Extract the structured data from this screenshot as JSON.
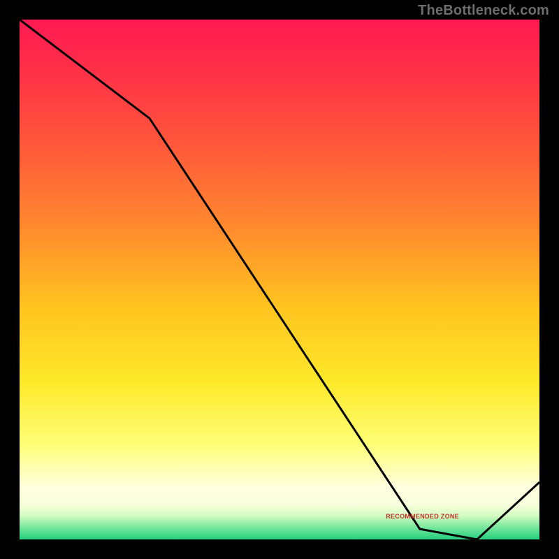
{
  "watermark": "TheBottleneck.com",
  "annotation_label": "RECOMMENDED ZONE",
  "annotation_pos": {
    "x_frac": 0.775,
    "y_frac": 0.955
  },
  "chart_data": {
    "type": "line",
    "title": "",
    "xlabel": "",
    "ylabel": "",
    "xlim": [
      0,
      1
    ],
    "ylim": [
      0,
      1
    ],
    "x": [
      0.0,
      0.25,
      0.77,
      0.88,
      1.0
    ],
    "values": [
      1.0,
      0.81,
      0.02,
      0.0,
      0.11
    ],
    "gradient_stops": [
      {
        "pos": 0.0,
        "color": "#ff1a52"
      },
      {
        "pos": 0.1,
        "color": "#ff3047"
      },
      {
        "pos": 0.25,
        "color": "#ff5a3a"
      },
      {
        "pos": 0.4,
        "color": "#ff8a2e"
      },
      {
        "pos": 0.55,
        "color": "#ffc31f"
      },
      {
        "pos": 0.7,
        "color": "#fdea2a"
      },
      {
        "pos": 0.82,
        "color": "#feff7a"
      },
      {
        "pos": 0.9,
        "color": "#ffffe0"
      },
      {
        "pos": 0.935,
        "color": "#f7ffdb"
      },
      {
        "pos": 0.955,
        "color": "#d2fbc0"
      },
      {
        "pos": 0.975,
        "color": "#7fe9a1"
      },
      {
        "pos": 1.0,
        "color": "#23d07e"
      }
    ],
    "line_color": "#000000",
    "line_width": 3
  }
}
